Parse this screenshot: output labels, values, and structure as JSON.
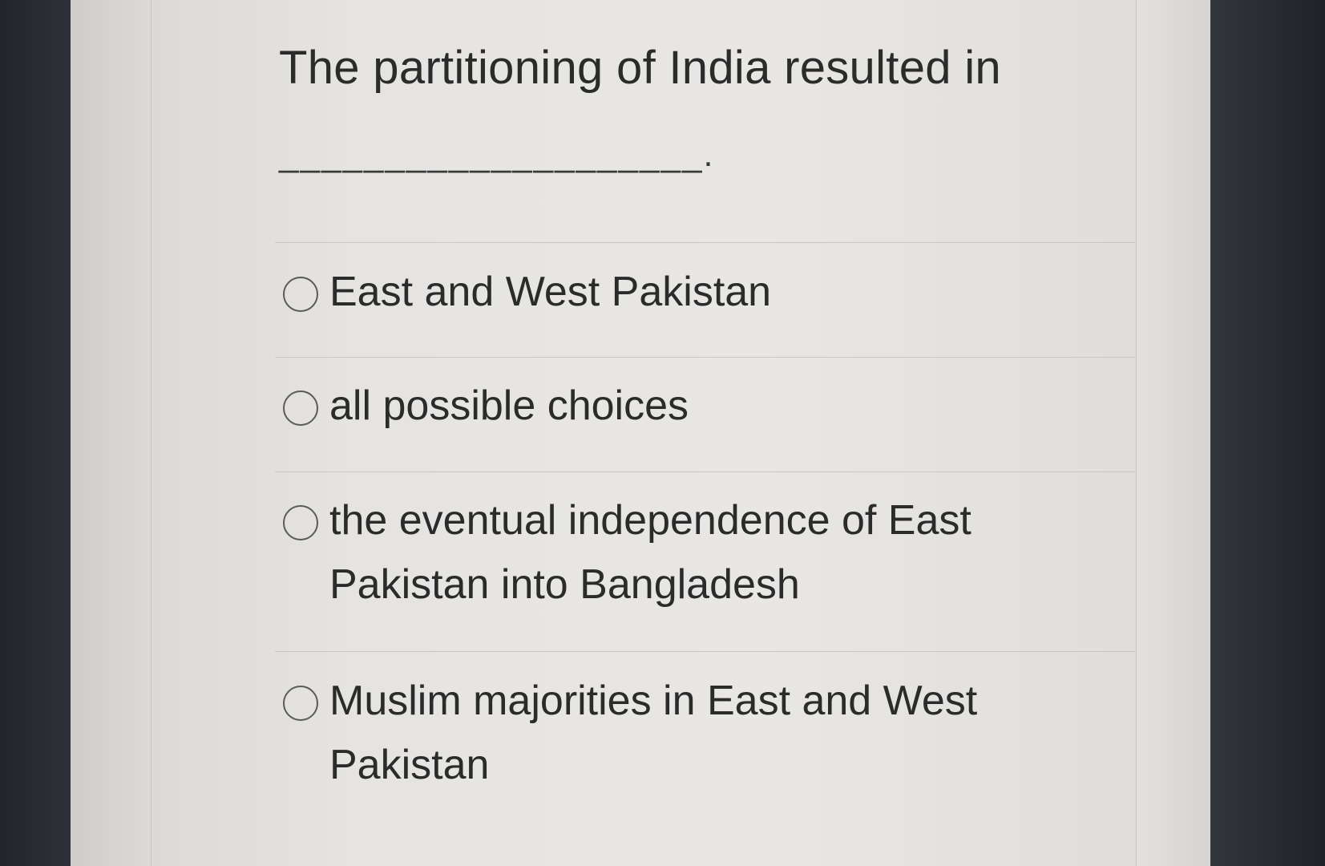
{
  "question": {
    "text": "The partitioning of India resulted in",
    "blank": "____________________."
  },
  "options": [
    {
      "label": "East and West Pakistan"
    },
    {
      "label": "all possible choices"
    },
    {
      "label": "the eventual independence of East Pakistan into Bangladesh"
    },
    {
      "label": "Muslim majorities in East and West Pakistan"
    }
  ]
}
